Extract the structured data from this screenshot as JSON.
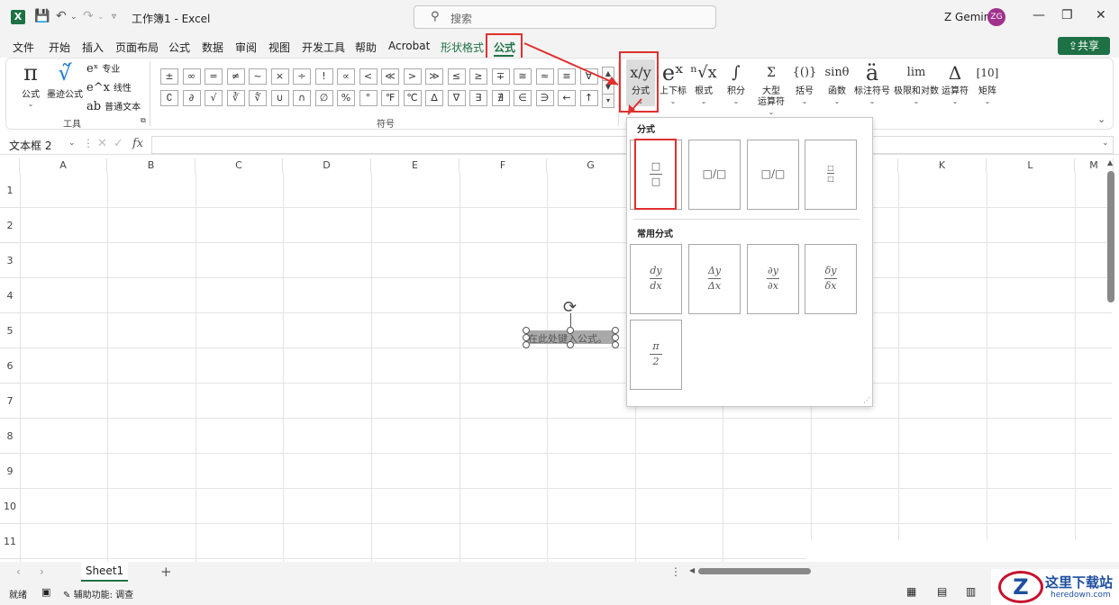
{
  "titlebar": {
    "doc_title": "工作簿1 - Excel",
    "search_placeholder": "搜索",
    "user_name": "Z Gemini",
    "avatar_initials": "ZG"
  },
  "menu": [
    "文件",
    "开始",
    "插入",
    "页面布局",
    "公式",
    "数据",
    "审阅",
    "视图",
    "开发工具",
    "帮助",
    "Acrobat",
    "形状格式",
    "公式"
  ],
  "share_label": "共享",
  "ribbon": {
    "tools_group": "工具",
    "symbols_group": "符号",
    "formula_label": "公式",
    "ink_label": "墨迹公式",
    "professional_label": "专业",
    "linear_label": "线性",
    "plain_text_label": "普通文本",
    "symbols_row1": [
      "±",
      "∞",
      "=",
      "≠",
      "~",
      "×",
      "÷",
      "!",
      "∝",
      "<",
      "≪",
      ">",
      "≫",
      "≤",
      "≥",
      "∓",
      "≅",
      "≈",
      "≡",
      "∀"
    ],
    "symbols_row2": [
      "∁",
      "∂",
      "√",
      "∛",
      "∜",
      "∪",
      "∩",
      "∅",
      "%",
      "°",
      "℉",
      "℃",
      "∆",
      "∇",
      "∃",
      "∄",
      "∈",
      "∋",
      "←",
      "↑"
    ],
    "structures": [
      {
        "glyph": "x/y",
        "label": "分式"
      },
      {
        "glyph": "eˣ",
        "label": "上下标"
      },
      {
        "glyph": "ⁿ√x",
        "label": "根式"
      },
      {
        "glyph": "∫",
        "label": "积分"
      },
      {
        "glyph": "Σ",
        "label": "大型\n运算符"
      },
      {
        "glyph": "{()}",
        "label": "括号"
      },
      {
        "glyph": "sinθ",
        "label": "函数"
      },
      {
        "glyph": "ä",
        "label": "标注符号"
      },
      {
        "glyph": "lim",
        "label": "极限和对数"
      },
      {
        "glyph": "Δ",
        "label": "运算符"
      },
      {
        "glyph": "[10]",
        "label": "矩阵"
      }
    ]
  },
  "formula_bar": {
    "name_box": "文本框 2",
    "fx": "fx"
  },
  "columns": [
    "A",
    "B",
    "C",
    "D",
    "E",
    "F",
    "G",
    "H",
    "I",
    "J",
    "K",
    "L",
    "M"
  ],
  "rows": [
    "1",
    "2",
    "3",
    "4",
    "5",
    "6",
    "7",
    "8",
    "9",
    "10",
    "11"
  ],
  "textbox_placeholder": "在此处键入公式。",
  "dropdown": {
    "section1_title": "分式",
    "section2_title": "常用分式",
    "common": [
      {
        "num": "dy",
        "den": "dx"
      },
      {
        "num": "Δy",
        "den": "Δx"
      },
      {
        "num": "∂y",
        "den": "∂x"
      },
      {
        "num": "δy",
        "den": "δx"
      },
      {
        "num": "π",
        "den": "2"
      }
    ]
  },
  "status": {
    "ready": "就绪",
    "accessibility": "辅助功能: 调查",
    "sheet_name": "Sheet1"
  },
  "watermark": {
    "text": "这里下载站",
    "url": "heredown.com"
  }
}
